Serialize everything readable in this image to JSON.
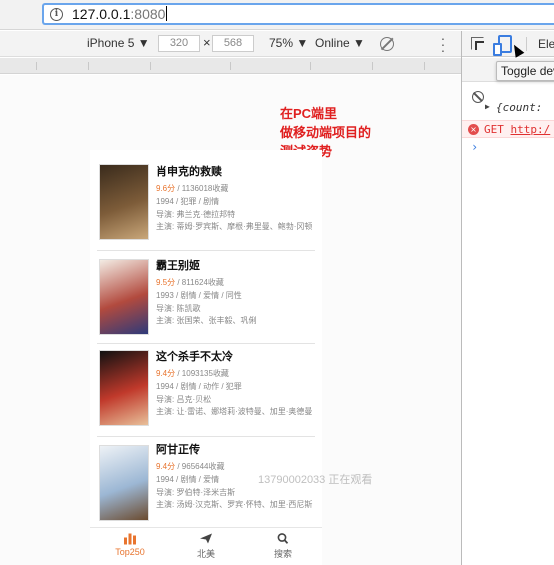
{
  "browser": {
    "url_host": "127.0.0.1",
    "url_port": ":8080"
  },
  "device_toolbar": {
    "device": "iPhone 5 ▼",
    "width": "320",
    "times": "×",
    "height": "568",
    "zoom": "75% ▼",
    "network": "Online ▼"
  },
  "movies": [
    {
      "title": "肖申克的救赎",
      "rating": "9.6分",
      "stats": " / 1136018收藏",
      "meta": "1994 / 犯罪 / 剧情",
      "director": "导演: 弗兰克·德拉邦特",
      "cast": "主演: 蒂姆·罗宾斯、摩根·弗里曼、鲍勃·冈顿",
      "poster_colors": [
        "#3a2b1c",
        "#7d5c39",
        "#c9a77a"
      ]
    },
    {
      "title": "霸王别姬",
      "rating": "9.5分",
      "stats": " / 811624收藏",
      "meta": "1993 / 剧情 / 爱情 / 同性",
      "director": "导演: 陈凯歌",
      "cast": "主演: 张国荣、张丰毅、巩俐",
      "poster_colors": [
        "#f3ece4",
        "#b24a3e",
        "#2e3a7a"
      ]
    },
    {
      "title": "这个杀手不太冷",
      "rating": "9.4分",
      "stats": " / 1093135收藏",
      "meta": "1994 / 剧情 / 动作 / 犯罪",
      "director": "导演: 吕克·贝松",
      "cast": "主演: 让·雷诺、娜塔莉·波特曼、加里·奥德曼",
      "poster_colors": [
        "#111111",
        "#c0392b",
        "#e8c09a"
      ]
    },
    {
      "title": "阿甘正传",
      "rating": "9.4分",
      "stats": " / 965644收藏",
      "meta": "1994 / 剧情 / 爱情",
      "director": "导演: 罗伯特·泽米吉斯",
      "cast": "主演: 汤姆·汉克斯、罗宾·怀特、加里·西尼斯",
      "poster_colors": [
        "#eef2f6",
        "#9cb7d4",
        "#6b4b2f"
      ]
    }
  ],
  "tabs": [
    {
      "label": "Top250",
      "icon": "bar-chart-icon"
    },
    {
      "label": "北美",
      "icon": "plane-icon"
    },
    {
      "label": "搜索",
      "icon": "search-icon"
    }
  ],
  "devtools": {
    "elements_tab": "Ele",
    "tooltip": "Toggle dev",
    "log_text": "{count: ",
    "error_method": "GET",
    "error_url": "http:/",
    "prompt": "›"
  },
  "annotation": {
    "line1": "在PC端里",
    "line2": "做移动端项目的",
    "line3": "测试姿势"
  },
  "watermark": "13790002033 正在观看",
  "colors": {
    "accent": "#e8742e",
    "annotation": "#e02020",
    "devtools_blue": "#3b7de0"
  }
}
